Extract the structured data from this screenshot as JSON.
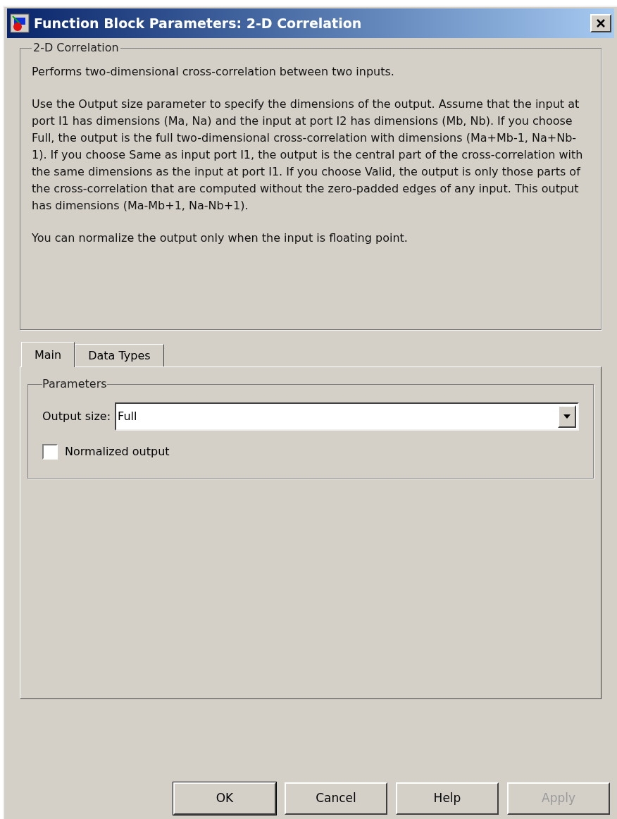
{
  "window": {
    "title": "Function Block Parameters: 2-D Correlation"
  },
  "description": {
    "title": "2-D Correlation",
    "paragraphs": [
      "Performs two-dimensional cross-correlation between two inputs.",
      "Use the Output size parameter to specify the dimensions of the output. Assume that the input at port I1 has dimensions (Ma, Na) and the input at port I2 has dimensions (Mb, Nb). If you choose Full, the output is the full two-dimensional cross-correlation with dimensions (Ma+Mb-1, Na+Nb-1). If you choose Same as input port I1, the output is the central part of the cross-correlation with the same dimensions as the input at port I1. If you choose Valid, the output is only those parts of the cross-correlation that are computed without the zero-padded edges of any input. This output has dimensions (Ma-Mb+1, Na-Nb+1).",
      "You can normalize the output only when the input is floating point."
    ]
  },
  "tabs": [
    {
      "label": "Main",
      "selected": true
    },
    {
      "label": "Data Types",
      "selected": false
    }
  ],
  "parameters": {
    "title": "Parameters",
    "output_size": {
      "label": "Output size:",
      "value": "Full"
    },
    "normalized_output": {
      "label": "Normalized output",
      "checked": false
    }
  },
  "buttons": [
    {
      "label": "OK",
      "disabled": false,
      "default": true
    },
    {
      "label": "Cancel",
      "disabled": false,
      "default": false
    },
    {
      "label": "Help",
      "disabled": false,
      "default": false
    },
    {
      "label": "Apply",
      "disabled": true,
      "default": false
    }
  ]
}
